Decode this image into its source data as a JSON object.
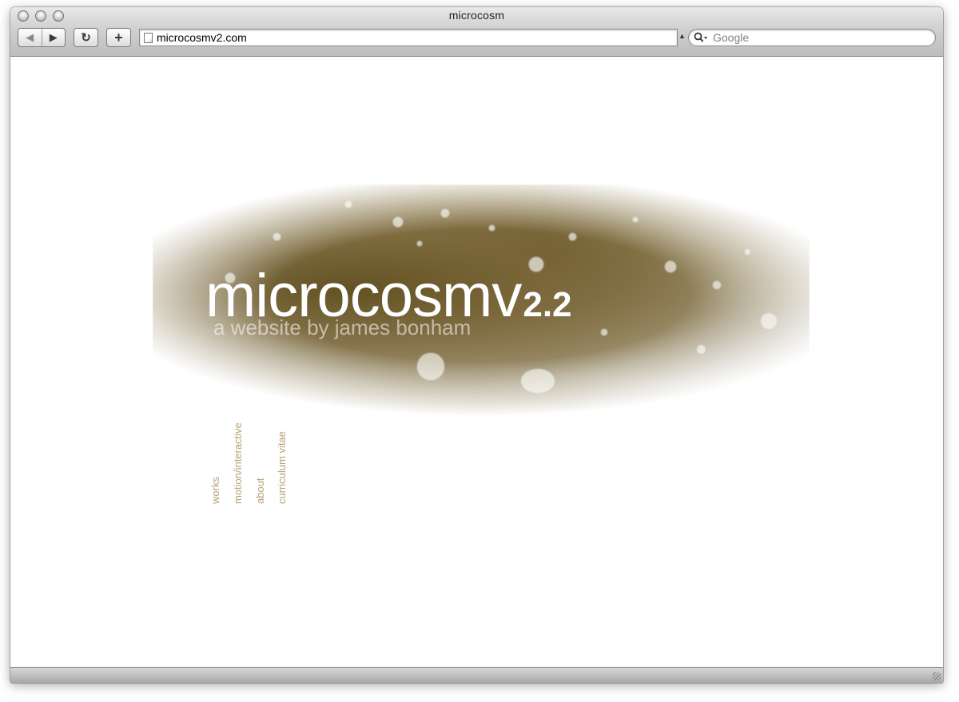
{
  "window": {
    "title": "microcosm"
  },
  "toolbar": {
    "back_icon": "back-arrow-icon",
    "forward_icon": "forward-arrow-icon",
    "reload_icon": "reload-icon",
    "add_bookmark_label": "+",
    "url": "microcosmv2.com",
    "search_placeholder": "Google"
  },
  "page": {
    "logo_main": "microcosmv",
    "logo_version": "2.2",
    "tagline": "a website by james bonham",
    "nav": [
      {
        "label": "works"
      },
      {
        "label": "motion/interactive"
      },
      {
        "label": "about"
      },
      {
        "label": "curriculum vitae"
      }
    ],
    "accent_color": "#b6a276"
  }
}
